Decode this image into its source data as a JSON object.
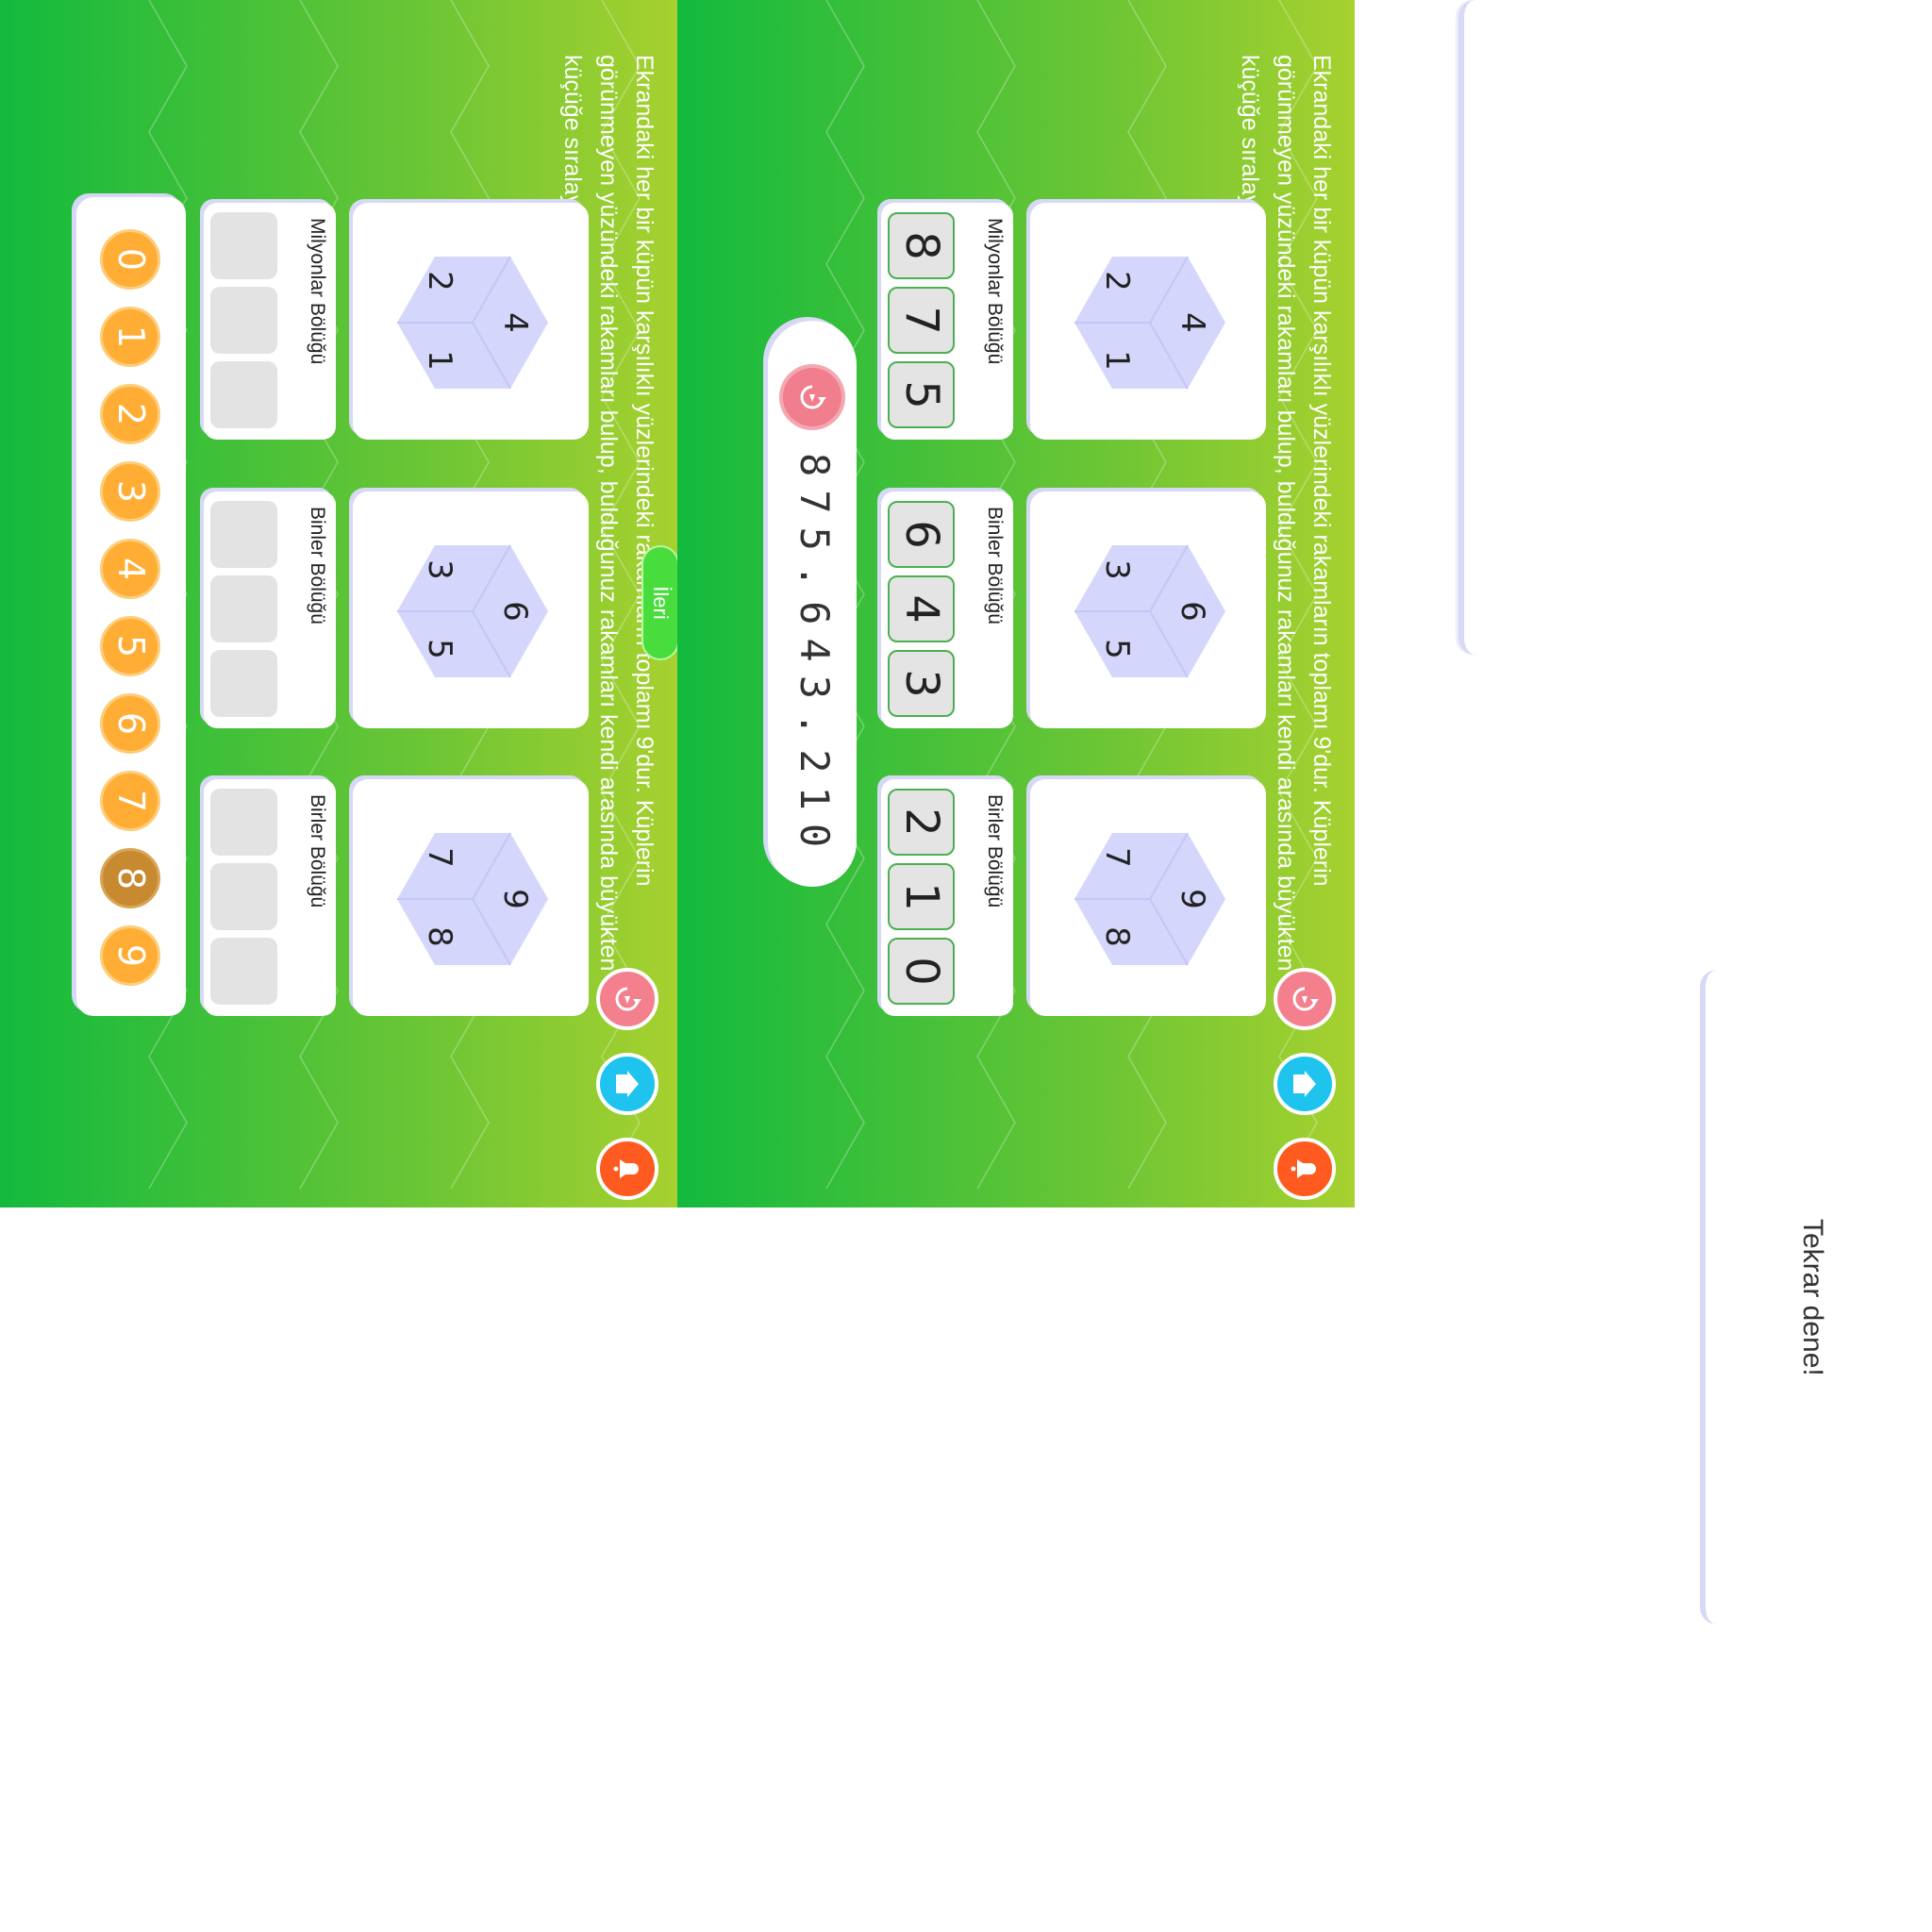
{
  "instruction": "Ekrandaki her bir küpün karşılıklı yüzlerindeki rakamların toplamı 9'dur. Küplerin görünmeyen yüzündeki rakamları bulup, bulduğunuz rakamları kendi arasında büyükten küçüğe sıralayın.",
  "cubes": [
    {
      "top": "4",
      "left": "2",
      "right": "1"
    },
    {
      "top": "6",
      "left": "3",
      "right": "5"
    },
    {
      "top": "9",
      "left": "7",
      "right": "8"
    }
  ],
  "groups": [
    {
      "label": "Milyonlar Bölüğü"
    },
    {
      "label": "Binler Bölüğü"
    },
    {
      "label": "Birler Bölüğü"
    }
  ],
  "answer_slots": [
    [
      "8",
      "7",
      "5"
    ],
    [
      "6",
      "4",
      "3"
    ],
    [
      "2",
      "1",
      "0"
    ]
  ],
  "result": {
    "text": "875.643.210"
  },
  "next_button": {
    "label": "İleri"
  },
  "number_pad": [
    "0",
    "1",
    "2",
    "3",
    "4",
    "5",
    "6",
    "7",
    "8",
    "9"
  ],
  "used_digit": "8",
  "colors": {
    "reset": "#f4808e",
    "home": "#1ec4ee",
    "sound": "#ff5a1f",
    "coin": "#ffad34",
    "cube": "#d4d7fb"
  },
  "icons": [
    "reset-icon",
    "home-icon",
    "sound-icon"
  ],
  "feedback": {
    "message": "Tekrar dene!"
  }
}
